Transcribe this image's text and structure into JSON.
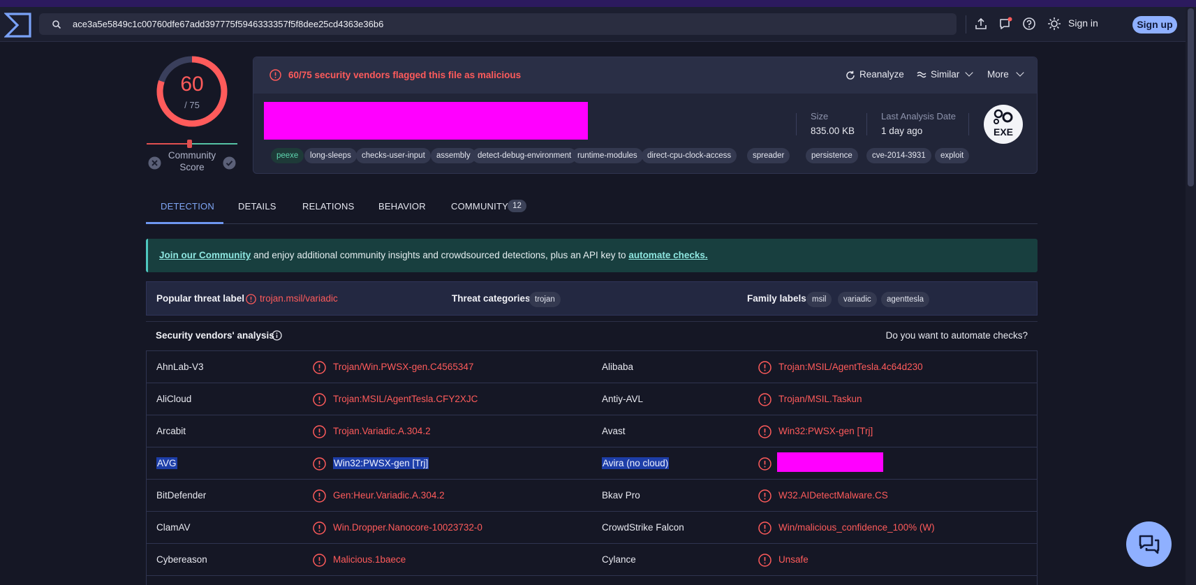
{
  "header": {
    "search_value": "ace3a5e5849c1c00760dfe67add397775f5946333357f5f8dee25cd4363e36b6",
    "sign_in": "Sign in",
    "sign_up": "Sign up"
  },
  "score": {
    "detections": "60",
    "total": "/ 75",
    "detection_fraction": 0.8,
    "community_label": "Community\nScore"
  },
  "file": {
    "flag_text": "60/75 security vendors flagged this file as malicious",
    "actions": {
      "reanalyze": "Reanalyze",
      "similar": "Similar",
      "more": "More"
    },
    "size_label": "Size",
    "size_value": "835.00 KB",
    "last_analysis_label": "Last Analysis Date",
    "last_analysis_value": "1 day ago",
    "type_badge": "EXE",
    "tags": [
      "peexe",
      "long-sleeps",
      "checks-user-input",
      "assembly",
      "detect-debug-environment",
      "runtime-modules",
      "direct-cpu-clock-access",
      "spreader",
      "persistence",
      "cve-2014-3931",
      "exploit"
    ]
  },
  "tabs": [
    {
      "label": "DETECTION",
      "active": true
    },
    {
      "label": "DETAILS"
    },
    {
      "label": "RELATIONS"
    },
    {
      "label": "BEHAVIOR"
    },
    {
      "label": "COMMUNITY",
      "badge": "12"
    }
  ],
  "banner": {
    "link1": "Join our Community",
    "middle": " and enjoy additional community insights and crowdsourced detections, plus an API key to ",
    "link2": "automate checks."
  },
  "threat": {
    "popular_label": "Popular threat label",
    "popular_value": "trojan.msil/variadic",
    "categories_label": "Threat categories",
    "categories": [
      "trojan"
    ],
    "family_label": "Family labels",
    "families": [
      "msil",
      "variadic",
      "agenttesla"
    ]
  },
  "vendors": {
    "title": "Security vendors' analysis",
    "automate_prompt": "Do you want to automate checks?",
    "rows": [
      {
        "left_name": "AhnLab-V3",
        "left_result": "Trojan/Win.PWSX-gen.C4565347",
        "right_name": "Alibaba",
        "right_result": "Trojan:MSIL/AgentTesla.4c64d230"
      },
      {
        "left_name": "AliCloud",
        "left_result": "Trojan:MSIL/AgentTesla.CFY2XJC",
        "right_name": "Antiy-AVL",
        "right_result": "Trojan/MSIL.Taskun"
      },
      {
        "left_name": "Arcabit",
        "left_result": "Trojan.Variadic.A.304.2",
        "right_name": "Avast",
        "right_result": "Win32:PWSX-gen [Trj]"
      },
      {
        "left_name": "AVG",
        "left_result": "Win32:PWSX-gen [Trj]",
        "right_name": "Avira (no cloud)",
        "right_result": ""
      },
      {
        "left_name": "BitDefender",
        "left_result": "Gen:Heur.Variadic.A.304.2",
        "right_name": "Bkav Pro",
        "right_result": "W32.AIDetectMalware.CS"
      },
      {
        "left_name": "ClamAV",
        "left_result": "Win.Dropper.Nanocore-10023732-0",
        "right_name": "CrowdStrike Falcon",
        "right_result": "Win/malicious_confidence_100% (W)"
      },
      {
        "left_name": "Cybereason",
        "left_result": "Malicious.1baece",
        "right_name": "Cylance",
        "right_result": "Unsafe"
      }
    ]
  }
}
